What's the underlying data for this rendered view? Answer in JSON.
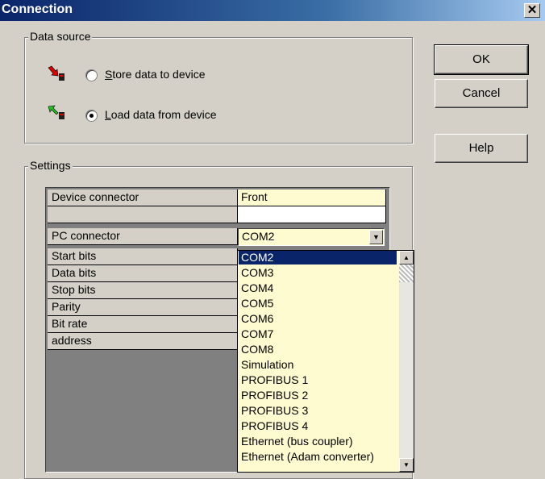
{
  "window": {
    "title": "Connection",
    "close_glyph": "✕"
  },
  "data_source": {
    "legend": "Data source",
    "options": [
      {
        "pre": "",
        "accel": "S",
        "post": "tore data to device",
        "selected": false,
        "icon": "store-to-device-icon"
      },
      {
        "pre": "",
        "accel": "L",
        "post": "oad data from device",
        "selected": true,
        "icon": "load-from-device-icon"
      }
    ]
  },
  "buttons": {
    "ok": "OK",
    "cancel": "Cancel",
    "help": "Help"
  },
  "settings": {
    "legend": "Settings",
    "rows": [
      {
        "name": "Device connector",
        "value": "Front"
      },
      {
        "name": "",
        "value": ""
      },
      {
        "name": "PC connector",
        "value": "COM2"
      },
      {
        "name": "Start bits",
        "value": ""
      },
      {
        "name": "Data bits",
        "value": ""
      },
      {
        "name": "Stop bits",
        "value": ""
      },
      {
        "name": "Parity",
        "value": ""
      },
      {
        "name": "Bit rate",
        "value": ""
      },
      {
        "name": "address",
        "value": ""
      }
    ]
  },
  "pc_connector_dropdown": {
    "selected": "COM2",
    "options": [
      "COM2",
      "COM3",
      "COM4",
      "COM5",
      "COM6",
      "COM7",
      "COM8",
      "Simulation",
      "PROFIBUS 1",
      "PROFIBUS 2",
      "PROFIBUS 3",
      "PROFIBUS 4",
      "Ethernet (bus coupler)",
      "Ethernet (Adam converter)"
    ]
  },
  "colors": {
    "title_bar": "#0a246a",
    "selection": "#0a246a",
    "value_cell": "#fffbd0",
    "dialog": "#d4d0c8"
  }
}
